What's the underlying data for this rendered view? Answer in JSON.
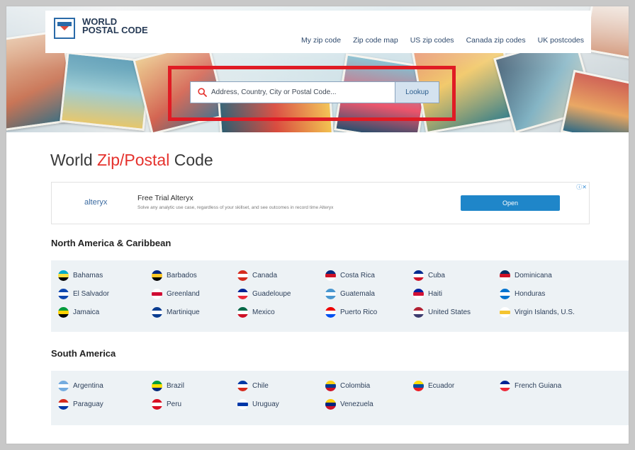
{
  "brand": {
    "line1": "WORLD",
    "line2": "POSTAL CODE"
  },
  "nav": [
    "My zip code",
    "Zip code map",
    "US zip codes",
    "Canada zip codes",
    "UK postcodes"
  ],
  "search": {
    "placeholder": "Address, Country, City or Postal Code...",
    "button": "Lookup"
  },
  "title": {
    "part1": "World ",
    "accent": "Zip/Postal",
    "part2": " Code"
  },
  "ad": {
    "brand": "alteryx",
    "title": "Free Trial Alteryx",
    "description": "Solve any analytic use case, regardless of your skillset, and see outcomes in record time Alteryx",
    "button": "Open",
    "choices": "ⓘ✕"
  },
  "sections": [
    {
      "title": "North America & Caribbean",
      "countries": [
        {
          "name": "Bahamas",
          "flag": [
            "#00abc9",
            "#fae042",
            "#000000"
          ]
        },
        {
          "name": "Barbados",
          "flag": [
            "#00267f",
            "#ffc726",
            "#000000"
          ]
        },
        {
          "name": "Canada",
          "flag": [
            "#d52b1e",
            "#ffffff",
            "#d52b1e"
          ]
        },
        {
          "name": "Costa Rica",
          "flag": [
            "#002b7f",
            "#ce1126",
            "#ffffff"
          ]
        },
        {
          "name": "Cuba",
          "flag": [
            "#002a8f",
            "#ffffff",
            "#cf142b"
          ]
        },
        {
          "name": "Dominicana",
          "flag": [
            "#002d62",
            "#ce1126",
            "#ffffff"
          ]
        },
        {
          "name": "El Salvador",
          "flag": [
            "#0f47af",
            "#ffffff",
            "#0f47af"
          ]
        },
        {
          "name": "Greenland",
          "flag": [
            "#ffffff",
            "#d00c33",
            "#ffffff"
          ]
        },
        {
          "name": "Guadeloupe",
          "flag": [
            "#002395",
            "#ffffff",
            "#ed2939"
          ]
        },
        {
          "name": "Guatemala",
          "flag": [
            "#4997d0",
            "#ffffff",
            "#4997d0"
          ]
        },
        {
          "name": "Haiti",
          "flag": [
            "#00209f",
            "#d21034",
            "#ffffff"
          ]
        },
        {
          "name": "Honduras",
          "flag": [
            "#0073cf",
            "#ffffff",
            "#0073cf"
          ]
        },
        {
          "name": "Jamaica",
          "flag": [
            "#009b3a",
            "#fed100",
            "#000000"
          ]
        },
        {
          "name": "Martinique",
          "flag": [
            "#0a3d91",
            "#ffffff",
            "#0a3d91"
          ]
        },
        {
          "name": "Mexico",
          "flag": [
            "#006847",
            "#ffffff",
            "#ce1126"
          ]
        },
        {
          "name": "Puerto Rico",
          "flag": [
            "#ed0000",
            "#ffffff",
            "#0050f0"
          ]
        },
        {
          "name": "United States",
          "flag": [
            "#b22234",
            "#ffffff",
            "#3c3b6e"
          ]
        },
        {
          "name": "Virgin Islands, U.S.",
          "flag": [
            "#ffffff",
            "#f4c430",
            "#ffffff"
          ]
        }
      ]
    },
    {
      "title": "South America",
      "countries": [
        {
          "name": "Argentina",
          "flag": [
            "#74acdf",
            "#ffffff",
            "#74acdf"
          ]
        },
        {
          "name": "Brazil",
          "flag": [
            "#009c3b",
            "#ffdf00",
            "#002776"
          ]
        },
        {
          "name": "Chile",
          "flag": [
            "#0039a6",
            "#ffffff",
            "#d52b1e"
          ]
        },
        {
          "name": "Colombia",
          "flag": [
            "#fcd116",
            "#003893",
            "#ce1126"
          ]
        },
        {
          "name": "Ecuador",
          "flag": [
            "#ffdd00",
            "#034ea2",
            "#ed1c24"
          ]
        },
        {
          "name": "French Guiana",
          "flag": [
            "#002395",
            "#ffffff",
            "#ed2939"
          ]
        },
        {
          "name": "Paraguay",
          "flag": [
            "#d52b1e",
            "#ffffff",
            "#0038a8"
          ]
        },
        {
          "name": "Peru",
          "flag": [
            "#d91023",
            "#ffffff",
            "#d91023"
          ]
        },
        {
          "name": "Uruguay",
          "flag": [
            "#ffffff",
            "#0038a8",
            "#ffffff"
          ]
        },
        {
          "name": "Venezuela",
          "flag": [
            "#ffcc00",
            "#00247d",
            "#cf142b"
          ]
        }
      ]
    }
  ]
}
